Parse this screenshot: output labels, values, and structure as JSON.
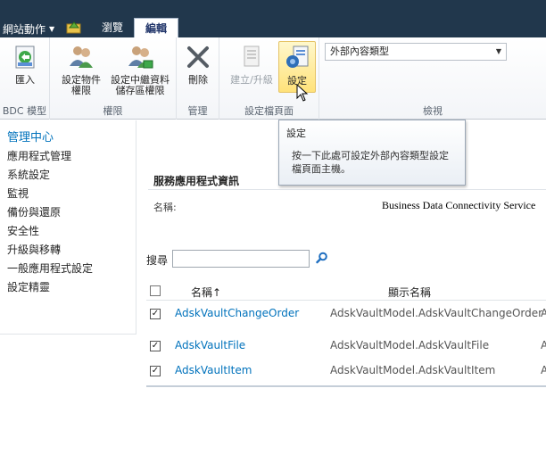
{
  "topbar": {
    "site_actions": "網站動作",
    "tabs": [
      {
        "label": "瀏覽"
      },
      {
        "label": "編輯"
      }
    ]
  },
  "ribbon": {
    "groups": [
      {
        "label": "BDC 模型",
        "buttons": [
          {
            "label": "匯入"
          }
        ]
      },
      {
        "label": "權限",
        "buttons": [
          {
            "label1": "設定物件",
            "label2": "權限"
          },
          {
            "label1": "設定中繼資料",
            "label2": "儲存區權限"
          }
        ]
      },
      {
        "label": "管理",
        "buttons": [
          {
            "label": "刪除"
          }
        ]
      },
      {
        "label": "設定檔頁面",
        "buttons": [
          {
            "label": "建立/升級"
          },
          {
            "label": "設定"
          }
        ]
      },
      {
        "label": "檢視",
        "select_value": "外部內容類型"
      }
    ]
  },
  "tooltip": {
    "title": "設定",
    "body": "按一下此處可設定外部內容類型設定檔頁面主機。"
  },
  "leftnav": {
    "heading": "管理中心",
    "items": [
      "應用程式管理",
      "系統設定",
      "監視",
      "備份與還原",
      "安全性",
      "升級與移轉",
      "一般應用程式設定",
      "設定精靈"
    ]
  },
  "service_info": {
    "title": "服務應用程式資訊",
    "name_label": "名稱:",
    "name_value": "Business Data Connectivity Service"
  },
  "search": {
    "label": "搜尋"
  },
  "table": {
    "columns": [
      "名稱↑",
      "顯示名稱"
    ],
    "rows": [
      {
        "name": "AdskVaultChangeOrder",
        "display": "AdskVaultModel.AdskVaultChangeOrder",
        "extra": "A"
      },
      {
        "name": "AdskVaultFile",
        "display": "AdskVaultModel.AdskVaultFile",
        "extra": "A"
      },
      {
        "name": "AdskVaultItem",
        "display": "AdskVaultModel.AdskVaultItem",
        "extra": "A"
      }
    ]
  }
}
